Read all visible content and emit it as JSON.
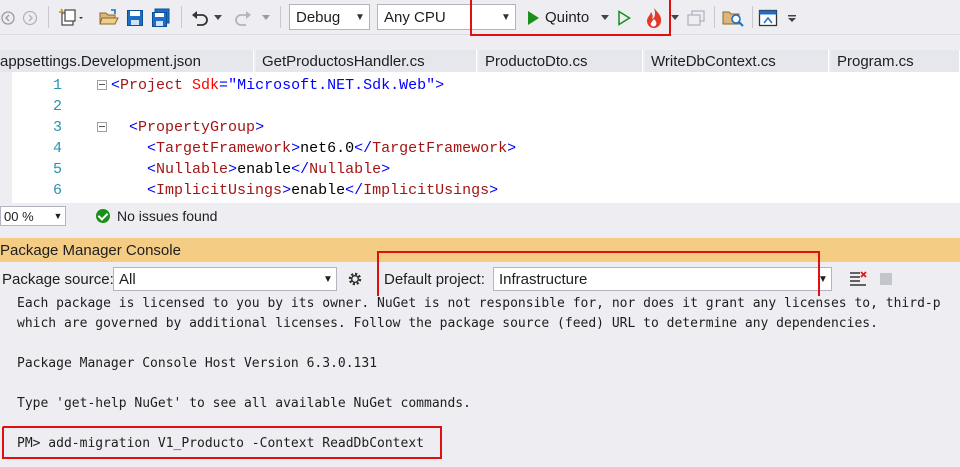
{
  "toolbar": {
    "configuration": "Debug",
    "platform": "Any CPU",
    "start_target": "Quinto",
    "icons": [
      "back-icon",
      "forward-icon",
      "new-project-icon",
      "open-folder-icon",
      "save-icon",
      "save-all-icon",
      "undo-icon",
      "redo-icon",
      "start-icon",
      "start-without-debug-icon",
      "hot-reload-icon",
      "windows-icon",
      "find-in-files-icon",
      "layout-icon"
    ]
  },
  "tabs": [
    "appsettings.Development.json",
    "GetProductosHandler.cs",
    "ProductoDto.cs",
    "WriteDbContext.cs",
    "Program.cs"
  ],
  "editor": {
    "lines": [
      {
        "num": "1",
        "indent": "",
        "bracket_open": "<",
        "element": "Project",
        "attr_name": " Sdk",
        "attr_eq": "=",
        "attr_value": "\"Microsoft.NET.Sdk.Web\"",
        "bracket_close": ">",
        "text": "",
        "end_open": "",
        "end_element": "",
        "end_close": "",
        "fold": true
      },
      {
        "num": "2",
        "indent": "",
        "bracket_open": "",
        "element": "",
        "attr_name": "",
        "attr_eq": "",
        "attr_value": "",
        "bracket_close": "",
        "text": "",
        "end_open": "",
        "end_element": "",
        "end_close": "",
        "fold": false
      },
      {
        "num": "3",
        "indent": "  ",
        "bracket_open": "<",
        "element": "PropertyGroup",
        "attr_name": "",
        "attr_eq": "",
        "attr_value": "",
        "bracket_close": ">",
        "text": "",
        "end_open": "",
        "end_element": "",
        "end_close": "",
        "fold": true
      },
      {
        "num": "4",
        "indent": "    ",
        "bracket_open": "<",
        "element": "TargetFramework",
        "attr_name": "",
        "attr_eq": "",
        "attr_value": "",
        "bracket_close": ">",
        "text": "net6.0",
        "end_open": "</",
        "end_element": "TargetFramework",
        "end_close": ">",
        "fold": false
      },
      {
        "num": "5",
        "indent": "    ",
        "bracket_open": "<",
        "element": "Nullable",
        "attr_name": "",
        "attr_eq": "",
        "attr_value": "",
        "bracket_close": ">",
        "text": "enable",
        "end_open": "</",
        "end_element": "Nullable",
        "end_close": ">",
        "fold": false
      },
      {
        "num": "6",
        "indent": "    ",
        "bracket_open": "<",
        "element": "ImplicitUsings",
        "attr_name": "",
        "attr_eq": "",
        "attr_value": "",
        "bracket_close": ">",
        "text": "enable",
        "end_open": "</",
        "end_element": "ImplicitUsings",
        "end_close": ">",
        "fold": false
      }
    ]
  },
  "status": {
    "zoom": "00 %",
    "issues": "No issues found"
  },
  "pmc": {
    "title": "Package Manager Console",
    "package_source_label": "Package source:",
    "package_source_value": "All",
    "default_project_label": "Default project:",
    "default_project_value": "Infrastructure",
    "console_lines": [
      "Each package is licensed to you by its owner. NuGet is not responsible for, nor does it grant any licenses to, third-p",
      "which are governed by additional licenses. Follow the package source (feed) URL to determine any dependencies.",
      "",
      "Package Manager Console Host Version 6.3.0.131",
      "",
      "Type 'get-help NuGet' to see all available NuGet commands.",
      "",
      "PM> add-migration V1_Producto -Context ReadDbContext"
    ]
  },
  "colors": {
    "accent_red": "#e01010",
    "pmc_title_bg": "#f5cc84",
    "run_green": "#1a8f1a"
  }
}
